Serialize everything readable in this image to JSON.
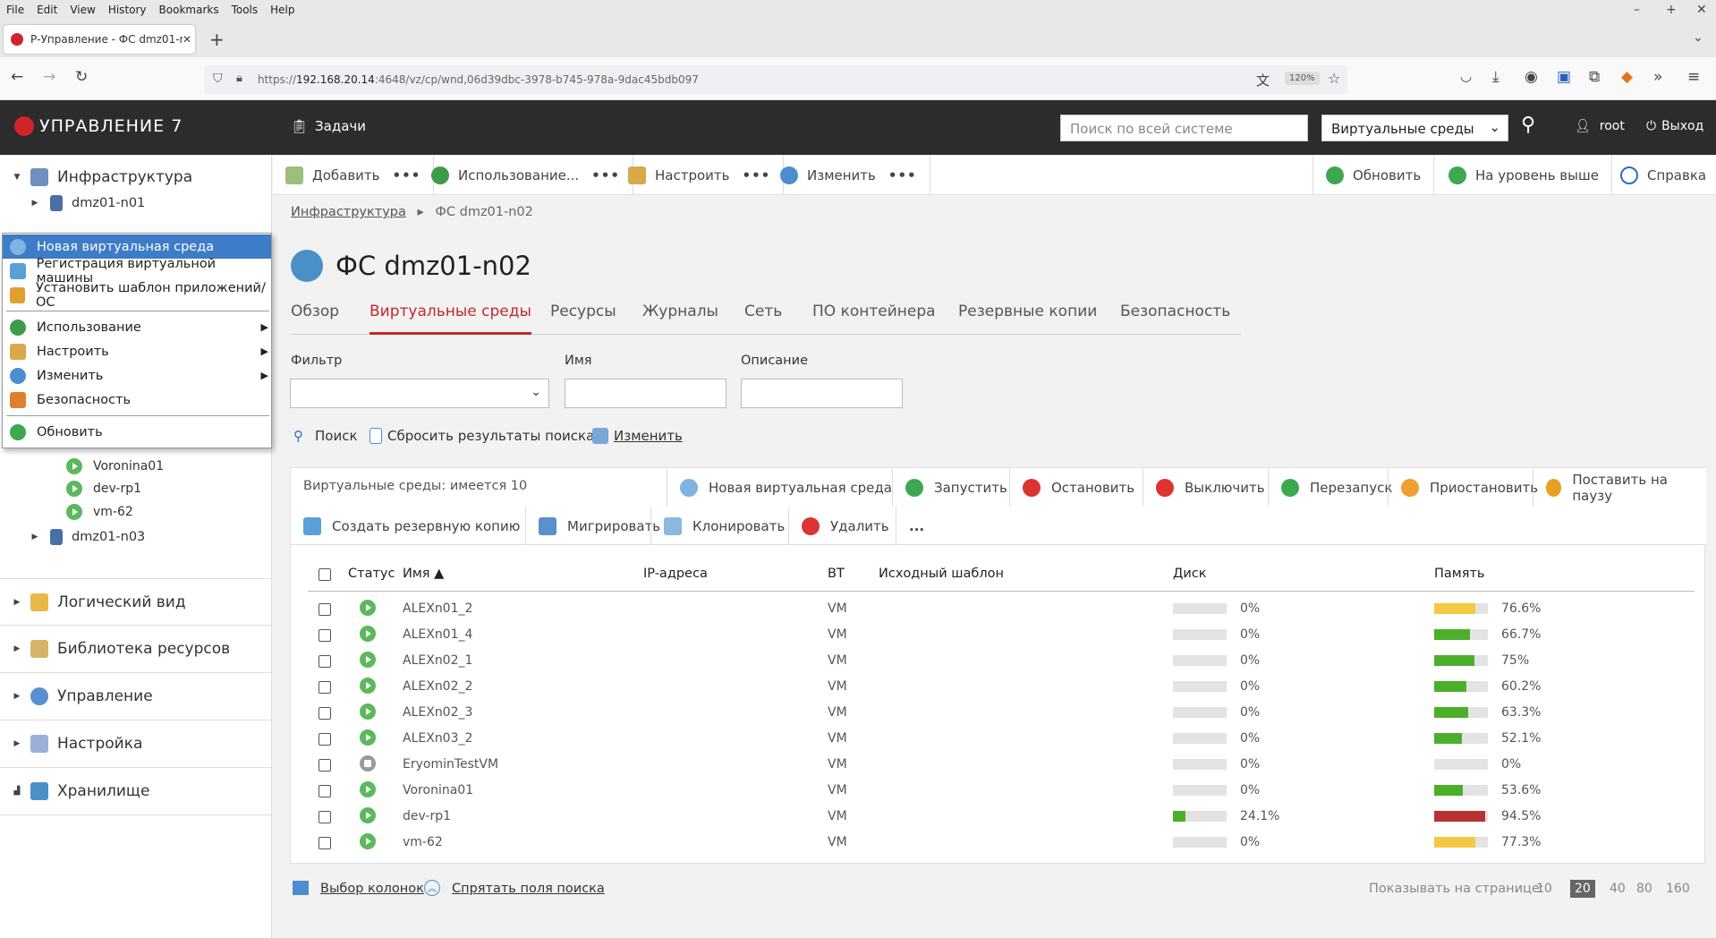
{
  "browser": {
    "menu": [
      "File",
      "Edit",
      "View",
      "History",
      "Bookmarks",
      "Tools",
      "Help"
    ],
    "tab_title": "Р-Управление - ФС dmz01-n0",
    "url_prefix": "https://",
    "url_host": "192.168.20.14",
    "url_rest": ":4648/vz/cp/wnd,06d39dbc-3978-b745-978a-9dac45bdb097",
    "zoom": "120%"
  },
  "header": {
    "logo": "УПРАВЛЕНИЕ 7",
    "tasks": "Задачи",
    "search_placeholder": "Поиск по всей системе",
    "env_select": "Виртуальные среды",
    "user": "root",
    "logout": "Выход"
  },
  "sidebar": {
    "infra": "Инфраструктура",
    "node1": "dmz01-n01",
    "vms": [
      "Voronina01",
      "dev-rp1",
      "vm-62"
    ],
    "node3": "dmz01-n03",
    "sections": [
      "Логический вид",
      "Библиотека ресурсов",
      "Управление",
      "Настройка",
      "Хранилище"
    ]
  },
  "context_menu": {
    "items": [
      "Новая виртуальная среда",
      "Регистрация виртуальной машины",
      "Установить шаблон приложений/ОС",
      "Использование",
      "Настроить",
      "Изменить",
      "Безопасность",
      "Обновить"
    ]
  },
  "toolbar": {
    "add": "Добавить",
    "usage": "Использование...",
    "configure": "Настроить",
    "change": "Изменить",
    "refresh": "Обновить",
    "up": "На уровень выше",
    "help": "Справка",
    "dots": "•••"
  },
  "breadcrumb": {
    "root": "Инфраструктура",
    "sep": "▸",
    "current": "ФС dmz01-n02"
  },
  "page_title": "ФС dmz01-n02",
  "tabs": [
    "Обзор",
    "Виртуальные среды",
    "Ресурсы",
    "Журналы",
    "Сеть",
    "ПО контейнера",
    "Резервные копии",
    "Безопасность"
  ],
  "filter": {
    "filter_label": "Фильтр",
    "name_label": "Имя",
    "desc_label": "Описание",
    "search": "Поиск",
    "reset": "Сбросить результаты поиска",
    "change": "Изменить"
  },
  "grid": {
    "count_text": "Виртуальные среды: имеется 10",
    "actions1": [
      "Новая виртуальная среда",
      "Запустить",
      "Остановить",
      "Выключить",
      "Перезапуск",
      "Приостановить",
      "Поставить на паузу"
    ],
    "actions2": [
      "Создать резервную копию",
      "Мигрировать",
      "Клонировать",
      "Удалить"
    ],
    "more": "...",
    "headers": {
      "status": "Статус",
      "name": "Имя ▲",
      "ip": "IP-адреса",
      "vt": "ВТ",
      "template": "Исходный шаблон",
      "disk": "Диск",
      "memory": "Память"
    },
    "rows": [
      {
        "name": "ALEXn01_2",
        "vt": "VM",
        "status": "running",
        "disk": 0,
        "disk_label": "0%",
        "mem": 76.6,
        "mem_label": "76.6%",
        "mem_color": "#f4c842"
      },
      {
        "name": "ALEXn01_4",
        "vt": "VM",
        "status": "running",
        "disk": 0,
        "disk_label": "0%",
        "mem": 66.7,
        "mem_label": "66.7%",
        "mem_color": "#4caf2a"
      },
      {
        "name": "ALEXn02_1",
        "vt": "VM",
        "status": "running",
        "disk": 0,
        "disk_label": "0%",
        "mem": 75,
        "mem_label": "75%",
        "mem_color": "#4caf2a"
      },
      {
        "name": "ALEXn02_2",
        "vt": "VM",
        "status": "running",
        "disk": 0,
        "disk_label": "0%",
        "mem": 60.2,
        "mem_label": "60.2%",
        "mem_color": "#4caf2a"
      },
      {
        "name": "ALEXn02_3",
        "vt": "VM",
        "status": "running",
        "disk": 0,
        "disk_label": "0%",
        "mem": 63.3,
        "mem_label": "63.3%",
        "mem_color": "#4caf2a"
      },
      {
        "name": "ALEXn03_2",
        "vt": "VM",
        "status": "running",
        "disk": 0,
        "disk_label": "0%",
        "mem": 52.1,
        "mem_label": "52.1%",
        "mem_color": "#4caf2a"
      },
      {
        "name": "EryominTestVM",
        "vt": "VM",
        "status": "stopped",
        "disk": 0,
        "disk_label": "0%",
        "mem": 0,
        "mem_label": "0%",
        "mem_color": "#4caf2a"
      },
      {
        "name": "Voronina01",
        "vt": "VM",
        "status": "running",
        "disk": 0,
        "disk_label": "0%",
        "mem": 53.6,
        "mem_label": "53.6%",
        "mem_color": "#4caf2a"
      },
      {
        "name": "dev-rp1",
        "vt": "VM",
        "status": "running",
        "disk": 24.1,
        "disk_label": "24.1%",
        "mem": 94.5,
        "mem_label": "94.5%",
        "mem_color": "#b83232"
      },
      {
        "name": "vm-62",
        "vt": "VM",
        "status": "running",
        "disk": 0,
        "disk_label": "0%",
        "mem": 77.3,
        "mem_label": "77.3%",
        "mem_color": "#f4c842"
      }
    ]
  },
  "footer": {
    "columns": "Выбор колонок",
    "hide": "Спрятать поля поиска",
    "per_page_label": "Показывать на странице:",
    "pages": [
      "10",
      "20",
      "40",
      "80",
      "160"
    ],
    "current": "20"
  },
  "colors": {
    "accent": "#c2292f",
    "selection": "#3d7cc7",
    "header_bg": "#2c2c2c"
  }
}
